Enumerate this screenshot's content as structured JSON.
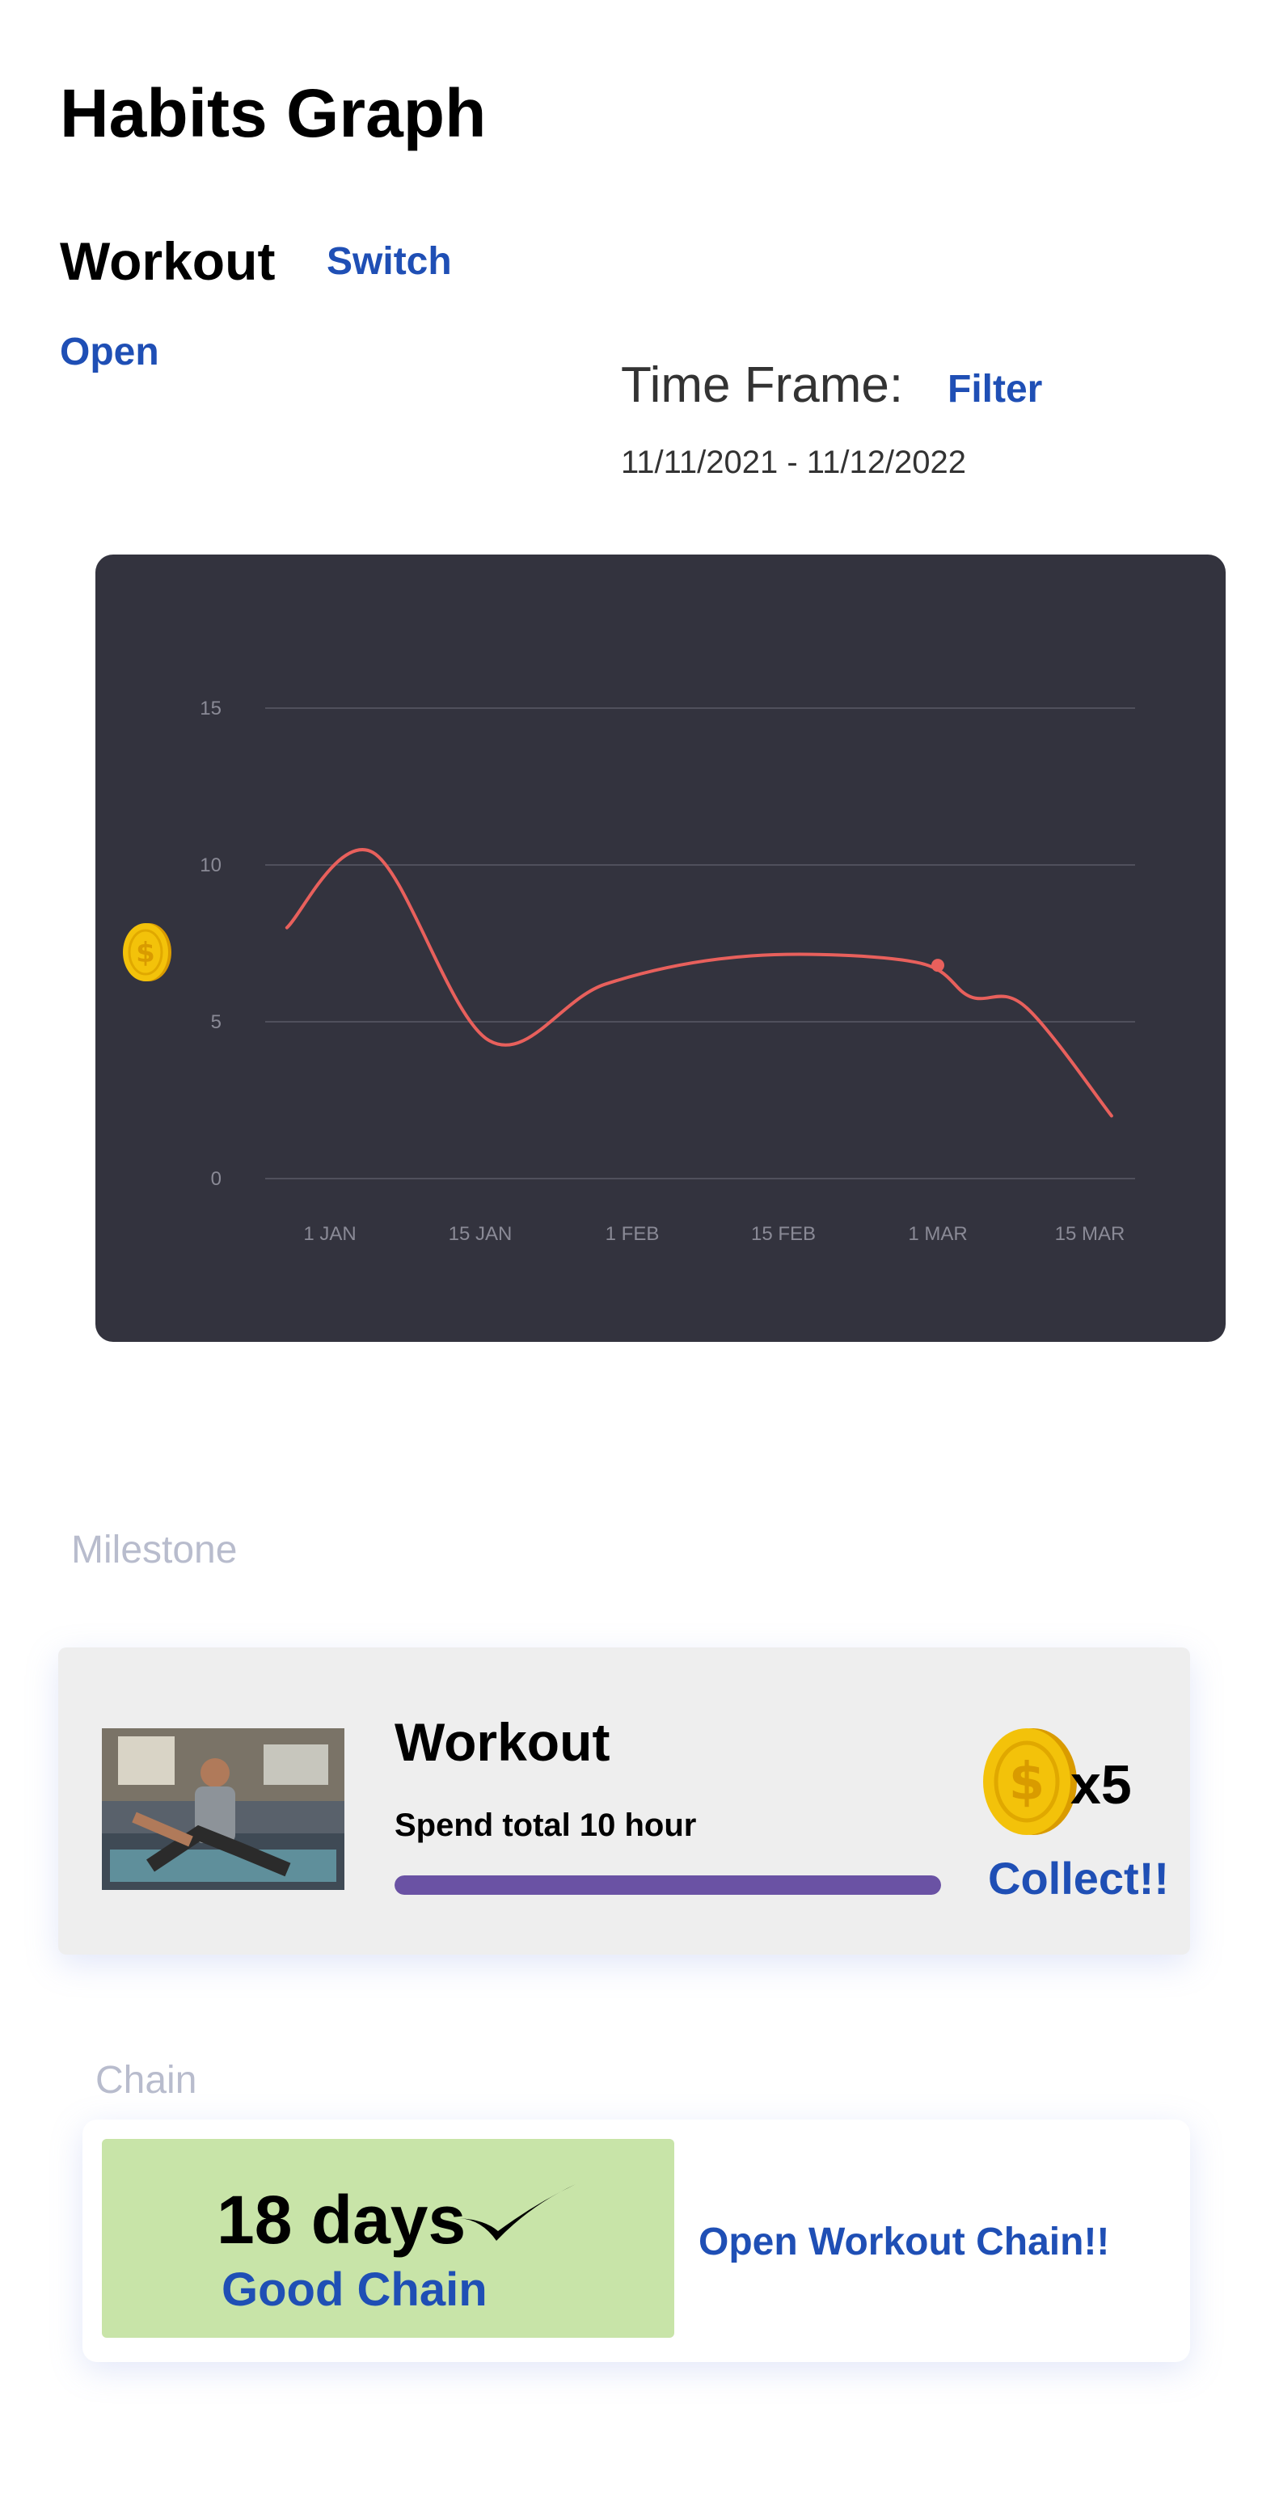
{
  "header": {
    "title": "Habits Graph"
  },
  "habit": {
    "name": "Workout",
    "switch_label": "Switch",
    "open_label": "Open"
  },
  "time_frame": {
    "label": "Time Frame:",
    "filter_label": "Filter",
    "range": "11/11/2021 - 11/12/2022"
  },
  "chart_data": {
    "type": "line",
    "x_ticks": [
      "1 JAN",
      "15 JAN",
      "1 FEB",
      "15 FEB",
      "1 MAR",
      "15 MAR"
    ],
    "y_ticks": [
      "0",
      "5",
      "10",
      "15"
    ],
    "ylim": [
      0,
      15
    ],
    "grid": true,
    "y_axis_icon": "coin-icon",
    "line_color": "#e8605c",
    "background": "#33333e",
    "series": [
      {
        "points": [
          {
            "x": "2021-12-28",
            "y": 8.0
          },
          {
            "x": "2022-01-05",
            "y": 10.4
          },
          {
            "x": "2022-01-16",
            "y": 4.4
          },
          {
            "x": "2022-01-29",
            "y": 6.2
          },
          {
            "x": "2022-02-12",
            "y": 7.1
          },
          {
            "x": "2022-02-27",
            "y": 6.9
          },
          {
            "x": "2022-03-04",
            "y": 5.8
          },
          {
            "x": "2022-03-09",
            "y": 5.5
          },
          {
            "x": "2022-03-17",
            "y": 2.0
          }
        ],
        "highlight": {
          "x": "2022-03-01",
          "y": 6.8
        }
      }
    ]
  },
  "milestone": {
    "section_label": "Milestone",
    "title": "Workout",
    "subtitle": "Spend total 10 hour",
    "progress": 1.0,
    "reward": "x5",
    "collect_label": "Collect!!"
  },
  "chain": {
    "section_label": "Chain",
    "days": "18 days",
    "status": "Good Chain",
    "open_label": "Open Workout Chain!!"
  },
  "colors": {
    "accent": "#1f4fb5",
    "progress": "#6a52a4",
    "chain_bg": "#c8e4a8",
    "coin": "#f3c20a"
  }
}
